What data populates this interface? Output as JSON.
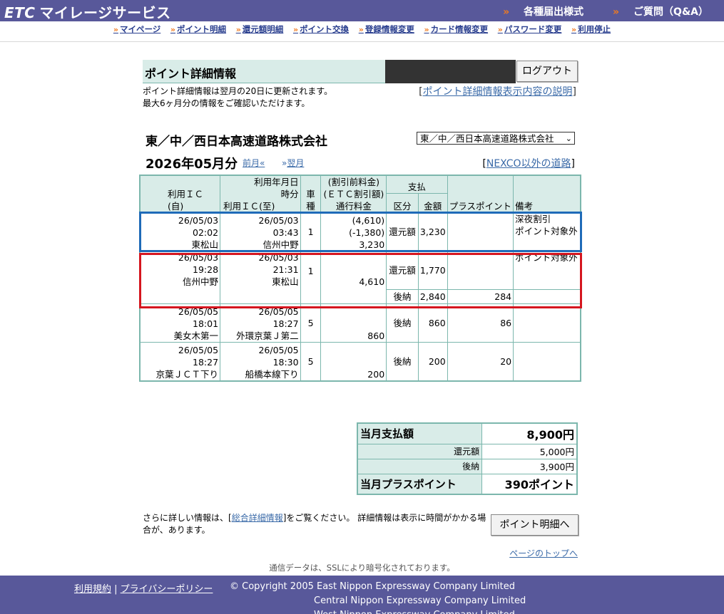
{
  "header": {
    "logo_mark": "ETC",
    "logo_text": "マイレージサービス",
    "links": [
      "各種届出様式",
      "ご質問（Q&A）"
    ]
  },
  "nav": [
    "マイページ",
    "ポイント明細",
    "還元額明細",
    "ポイント交換",
    "登録情報変更",
    "カード情報変更",
    "パスワード変更",
    "利用停止"
  ],
  "page": {
    "title": "ポイント詳細情報",
    "logout_label": "ログアウト",
    "note_line1": "ポイント詳細情報は翌月の20日に更新されます。",
    "note_line2": "最大6ヶ月分の情報をご確認いただけます。",
    "explain_link": "ポイント詳細情報表示内容の説明"
  },
  "company": {
    "name": "東／中／西日本高速道路株式会社",
    "select_value": "東／中／西日本高速道路株式会社"
  },
  "period": {
    "month": "2026年05月分",
    "prev_label": "前月«",
    "next_label": "翌月",
    "other_roads_link": "NEXCO以外の道路"
  },
  "table": {
    "headers": {
      "date_time": [
        "利用年月日",
        "時分"
      ],
      "ic_from": "利用ＩＣ(自)",
      "ic_to": "利用ＩＣ(至)",
      "vehicle": "車種",
      "fee": [
        "(割引前料金)",
        "(ＥＴＣ割引額)",
        "通行料金"
      ],
      "payment": "支払",
      "pay_type": "区分",
      "pay_amount": "金額",
      "plus_point": "プラスポイント",
      "remarks": "備考"
    },
    "rows": [
      {
        "from_date": "26/05/03",
        "from_time": "02:02",
        "from_ic": "東松山",
        "to_date": "26/05/03",
        "to_time": "03:43",
        "to_ic": "信州中野",
        "vehicle": "1",
        "fee_before": "(4,610)",
        "fee_discount": "(-1,380)",
        "fee": "3,230",
        "pay_type": "還元額",
        "pay_amount": "3,230",
        "points": "",
        "remark1": "深夜割引",
        "remark2": "ポイント対象外"
      },
      {
        "from_date": "26/05/03",
        "from_time": "19:28",
        "from_ic": "信州中野",
        "to_date": "26/05/03",
        "to_time": "21:31",
        "to_ic": "東松山",
        "vehicle": "1",
        "fee_before": "",
        "fee_discount": "",
        "fee": "4,610",
        "pay_type": "還元額",
        "pay_amount": "1,770",
        "points": "",
        "remark1": "ポイント対象外",
        "remark2": ""
      },
      {
        "from_date": "26/05/05",
        "from_time": "18:01",
        "from_ic": "美女木第一",
        "to_date": "26/05/05",
        "to_time": "18:27",
        "to_ic": "外環京葉Ｊ第二",
        "vehicle": "5",
        "fee_before": "",
        "fee_discount": "",
        "fee": "860",
        "pay_type": "後納",
        "pay_amount": "860",
        "points": "86",
        "remark1": "",
        "remark2": ""
      },
      {
        "from_date": "26/05/05",
        "from_time": "18:27",
        "from_ic": "京葉ＪＣＴ下り",
        "to_date": "26/05/05",
        "to_time": "18:30",
        "to_ic": "船橋本線下り",
        "vehicle": "5",
        "fee_before": "",
        "fee_discount": "",
        "fee": "200",
        "pay_type": "後納",
        "pay_amount": "200",
        "points": "20",
        "remark1": "",
        "remark2": ""
      }
    ],
    "split_row": {
      "pay_type": "後納",
      "pay_amount": "2,840",
      "points": "284"
    }
  },
  "summary": {
    "total_label": "当月支払額",
    "total_value": "8,900円",
    "refund_label": "還元額",
    "refund_value": "5,000円",
    "later_label": "後納",
    "later_value": "3,900円",
    "points_label": "当月プラスポイント",
    "points_value": "390ポイント"
  },
  "more": {
    "text_before": "さらに詳しい情報は、[",
    "link": "総合詳細情報",
    "text_after": "]をご覧ください。 詳細情報は表示に時間がかかる場合が、あります。",
    "button_label": "ポイント明細へ"
  },
  "to_top": "ページのトップへ",
  "ssl_note": "通信データは、SSLにより暗号化されております。",
  "footer": {
    "terms": "利用規約",
    "privacy": "プライバシーポリシー",
    "copyright": [
      "© Copyright 2005 East Nippon Expressway Company Limited",
      "Central Nippon Expressway Company Limited",
      "West Nippon Expressway Company Limited"
    ]
  },
  "colors": {
    "header_bg": "#58589a",
    "table_border": "#7cb7ad",
    "header_cell": "#d9ece8",
    "highlight_blue": "#1f6bb8",
    "highlight_red": "#d5161f",
    "link": "#3a6aa8",
    "arrow": "#f07a1f"
  }
}
